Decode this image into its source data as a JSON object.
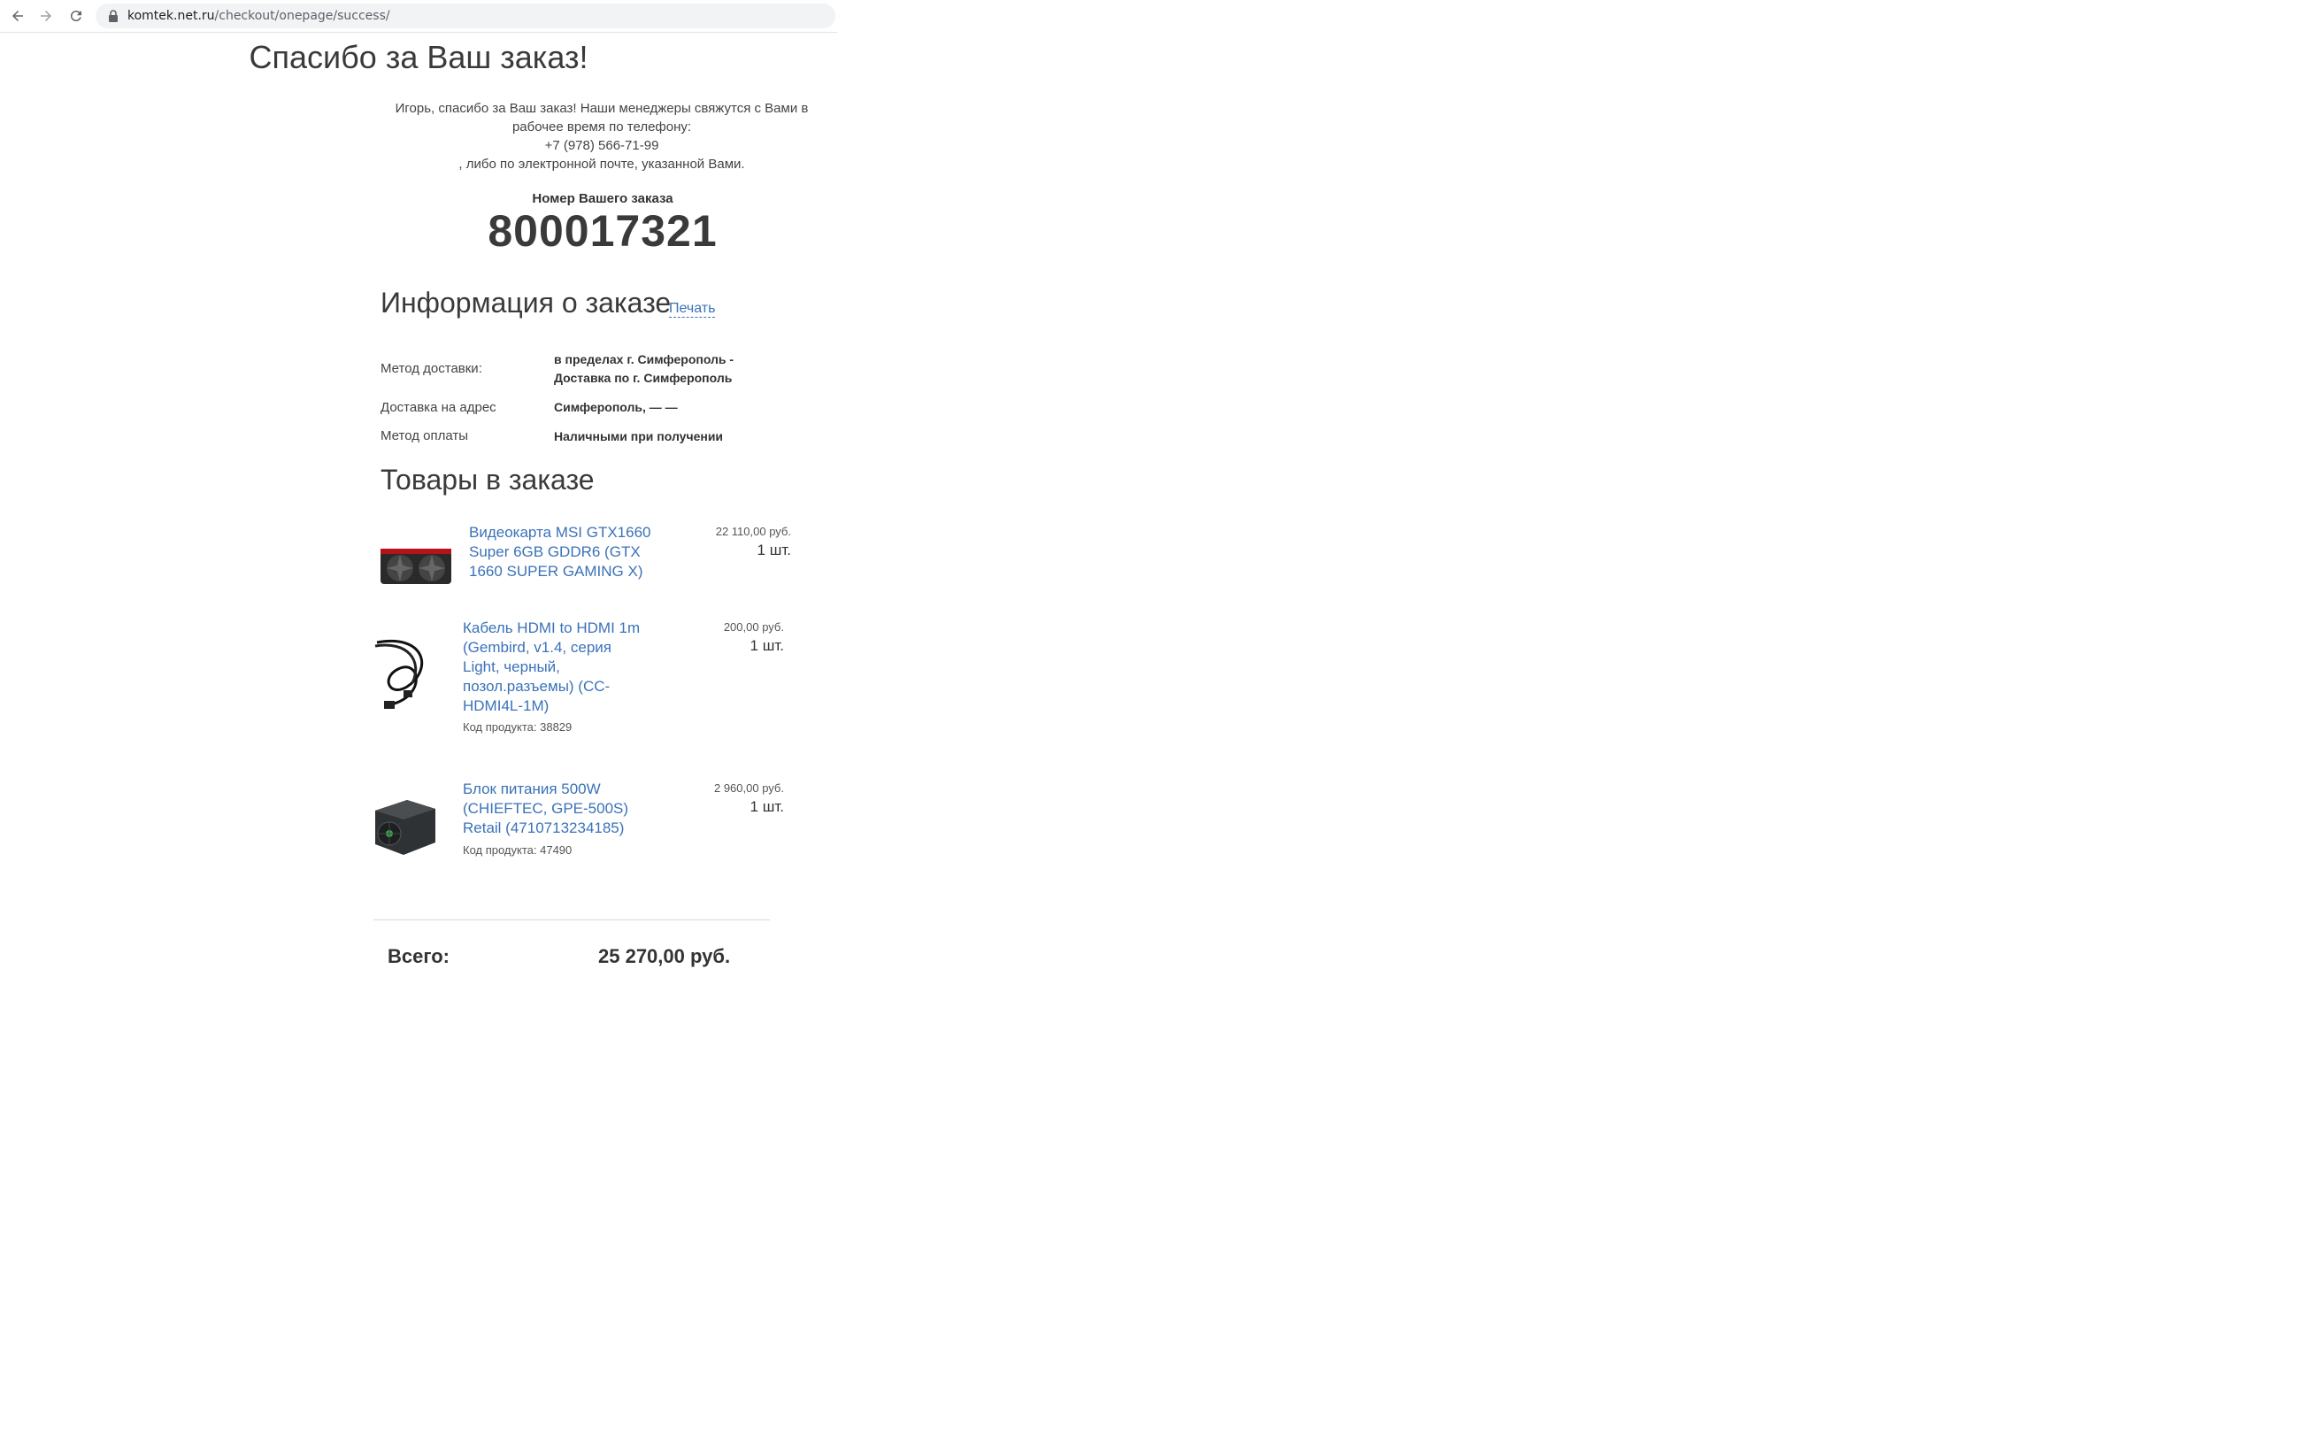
{
  "browser": {
    "url_host": "komtek.net.ru",
    "url_path": "/checkout/onepage/success/"
  },
  "success": {
    "title": "Спасибо за Ваш заказ!",
    "message_line1": "Игорь, спасибо за Ваш заказ! Наши менеджеры свяжутся с Вами в рабочее время по телефону:",
    "phone": "+7 (978) 566-71-99",
    "message_line2": ", либо по электронной почте, указанной Вами.",
    "order_number_label": "Номер Вашего заказа",
    "order_number": "800017321"
  },
  "order_info": {
    "title": "Информация о заказе",
    "print_label": "Печать",
    "rows": [
      {
        "label": "Метод доставки:",
        "value": "в пределах г. Симферополь - Доставка по г. Симферополь"
      },
      {
        "label": "Доставка на адрес",
        "value": "Симферополь, — —"
      },
      {
        "label": "Метод оплаты",
        "value": "Наличными при получении"
      }
    ]
  },
  "items": {
    "title": "Товары в заказе",
    "list": [
      {
        "name": "Видеокарта MSI GTX1660 Super 6GB GDDR6 (GTX 1660 SUPER GAMING X)",
        "code": "",
        "price": "22 110,00 руб.",
        "qty": "1 шт.",
        "icon": "graphics-card-image"
      },
      {
        "name": "Кабель HDMI to HDMI 1m (Gembird, v1.4, серия Light, черный, позол.разъемы) (CC-HDMI4L-1M)",
        "code": "Код продукта: 38829",
        "price": "200,00 руб.",
        "qty": "1 шт.",
        "icon": "hdmi-cable-image"
      },
      {
        "name": "Блок питания 500W (CHIEFTEC, GPE-500S) Retail (4710713234185)",
        "code": "Код продукта: 47490",
        "price": "2 960,00 руб.",
        "qty": "1 шт.",
        "icon": "power-supply-image"
      }
    ]
  },
  "total": {
    "label": "Всего:",
    "value": "25 270,00 руб."
  },
  "colors": {
    "link": "#3a72b8",
    "text": "#333333"
  }
}
